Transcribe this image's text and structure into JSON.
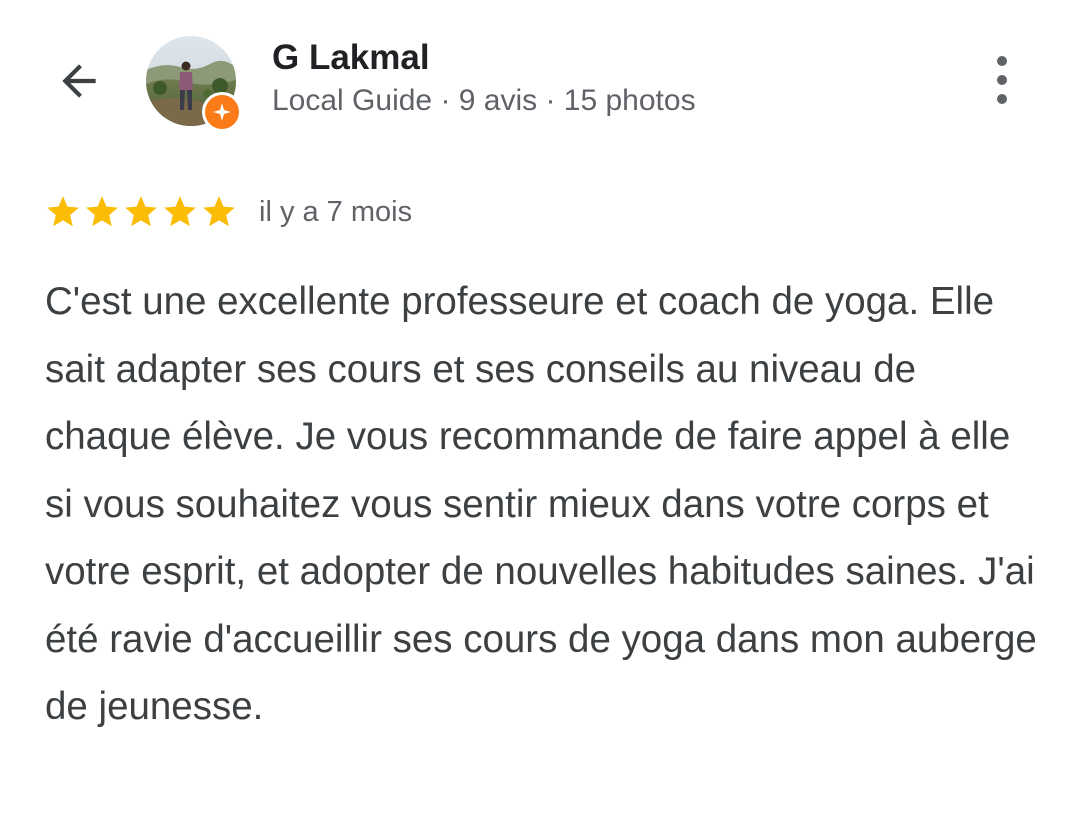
{
  "header": {
    "back_icon": "arrow-back-icon",
    "reviewer": {
      "name": "G Lakmal",
      "meta": "Local Guide · 9 avis · 15 photos",
      "badge_icon": "local-guide-star-icon",
      "badge_color": "#fa7b17"
    },
    "more_icon": "more-vert-icon"
  },
  "review": {
    "rating": 5,
    "max_rating": 5,
    "star_color": "#fbbc04",
    "time": "il y a 7 mois",
    "text": "C'est une excellente professeure et coach de yoga. Elle sait adapter ses cours et ses conseils au niveau de chaque élève. Je vous recommande de faire appel à elle si vous souhaitez vous sentir mieux dans votre corps et votre esprit, et adopter de nouvelles habitudes saines. J'ai été ravie d'accueillir ses cours de yoga dans mon auberge de jeunesse."
  },
  "colors": {
    "text_primary": "#202124",
    "text_body": "#3c4043",
    "text_secondary": "#5f6368"
  }
}
